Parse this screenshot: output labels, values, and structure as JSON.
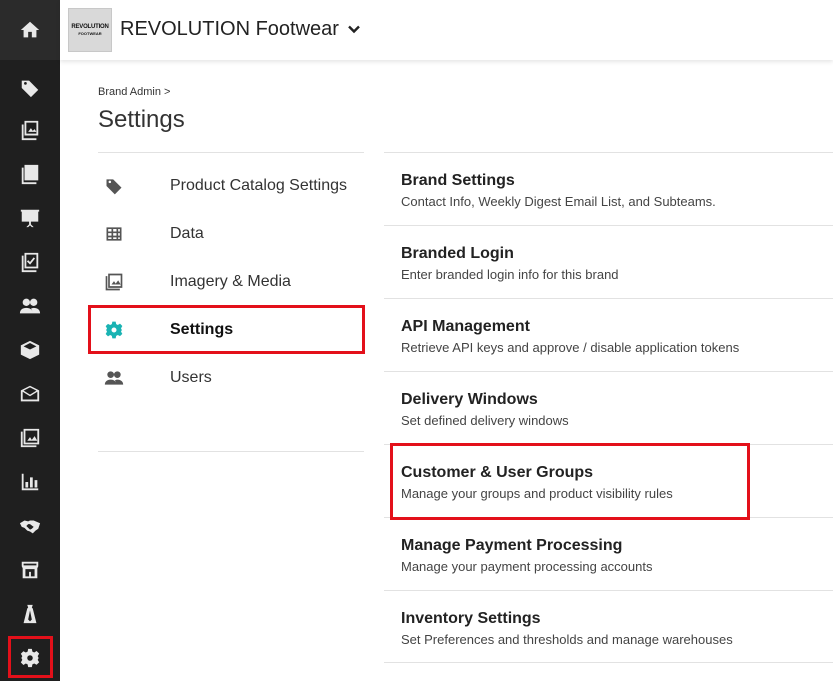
{
  "header": {
    "logo_line1": "REVOLUTION",
    "logo_line2": "FOOTWEAR",
    "brand_name": "REVOLUTION Footwear"
  },
  "breadcrumb": "Brand Admin >",
  "page_title": "Settings",
  "rail_icons": [
    "home-icon",
    "tag-icon",
    "photo-book-icon",
    "catalog-icon",
    "presentation-icon",
    "checklist-icon",
    "users-icon",
    "box-icon",
    "envelope-icon",
    "image-icon",
    "bar-chart-icon",
    "handshake-icon",
    "storefront-icon",
    "suit-icon",
    "gear-icon"
  ],
  "menu": {
    "items": [
      {
        "label": "Product Catalog Settings",
        "icon": "tag-icon"
      },
      {
        "label": "Data",
        "icon": "table-icon"
      },
      {
        "label": "Imagery & Media",
        "icon": "image-icon"
      },
      {
        "label": "Settings",
        "icon": "gear-icon",
        "active": true
      },
      {
        "label": "Users",
        "icon": "users-icon"
      }
    ]
  },
  "settings_list": [
    {
      "title": "Brand Settings",
      "desc": "Contact Info, Weekly Digest Email List, and Subteams."
    },
    {
      "title": "Branded Login",
      "desc": "Enter branded login info for this brand"
    },
    {
      "title": "API Management",
      "desc": "Retrieve API keys and approve / disable application tokens"
    },
    {
      "title": "Delivery Windows",
      "desc": "Set defined delivery windows"
    },
    {
      "title": "Customer & User Groups",
      "desc": "Manage your groups and product visibility rules"
    },
    {
      "title": "Manage Payment Processing",
      "desc": "Manage your payment processing accounts"
    },
    {
      "title": "Inventory Settings",
      "desc": "Set Preferences and thresholds and manage warehouses"
    }
  ],
  "colors": {
    "highlight": "#e3101a",
    "active_icon": "#1ab3b3",
    "rail_bg": "#1f1f1f"
  }
}
